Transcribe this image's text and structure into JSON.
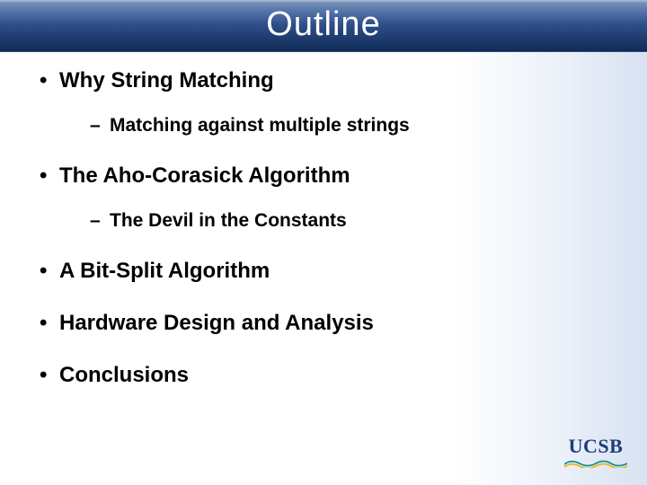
{
  "title": "Outline",
  "bullets": [
    {
      "text": "Why String Matching",
      "sub": [
        {
          "text": "Matching against multiple strings"
        }
      ]
    },
    {
      "text": "The Aho-Corasick Algorithm",
      "sub": [
        {
          "text": "The Devil in the Constants"
        }
      ]
    },
    {
      "text": "A Bit-Split Algorithm"
    },
    {
      "text": "Hardware Design and Analysis"
    },
    {
      "text": "Conclusions"
    }
  ],
  "logo": {
    "text": "UCSB"
  }
}
